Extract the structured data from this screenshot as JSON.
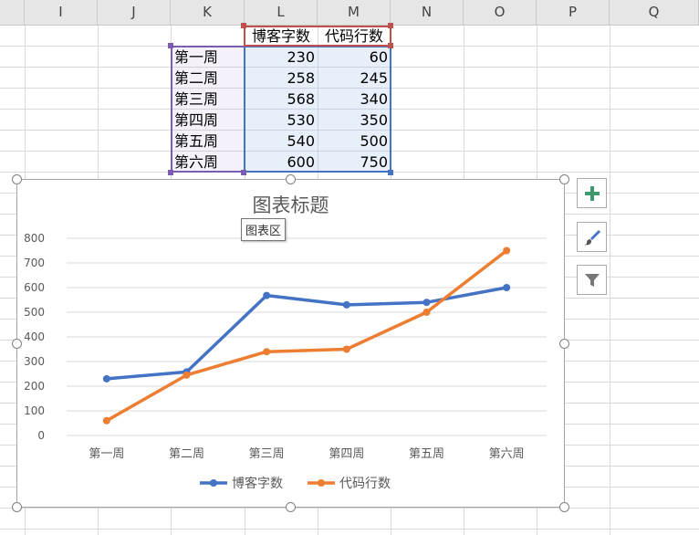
{
  "columns": [
    "I",
    "J",
    "K",
    "L",
    "M",
    "N",
    "O",
    "P",
    "Q"
  ],
  "table": {
    "headers": [
      "博客字数",
      "代码行数"
    ],
    "rows": [
      {
        "label": "第一周",
        "blog": "230",
        "code": "60"
      },
      {
        "label": "第二周",
        "blog": "258",
        "code": "245"
      },
      {
        "label": "第三周",
        "blog": "568",
        "code": "340"
      },
      {
        "label": "第四周",
        "blog": "530",
        "code": "350"
      },
      {
        "label": "第五周",
        "blog": "540",
        "code": "500"
      },
      {
        "label": "第六周",
        "blog": "600",
        "code": "750"
      }
    ]
  },
  "tooltip": "图表区",
  "chart_data": {
    "type": "line",
    "title": "图表标题",
    "categories": [
      "第一周",
      "第二周",
      "第三周",
      "第四周",
      "第五周",
      "第六周"
    ],
    "series": [
      {
        "name": "博客字数",
        "values": [
          230,
          258,
          568,
          530,
          540,
          600
        ],
        "color": "#4472c4"
      },
      {
        "name": "代码行数",
        "values": [
          60,
          245,
          340,
          350,
          500,
          750
        ],
        "color": "#ed7d31"
      }
    ],
    "ylim": [
      0,
      800
    ],
    "yticks": [
      0,
      100,
      200,
      300,
      400,
      500,
      600,
      700,
      800
    ],
    "grid": true,
    "legend": "bottom"
  },
  "side_buttons": [
    "plus-icon",
    "brush-icon",
    "filter-icon"
  ]
}
